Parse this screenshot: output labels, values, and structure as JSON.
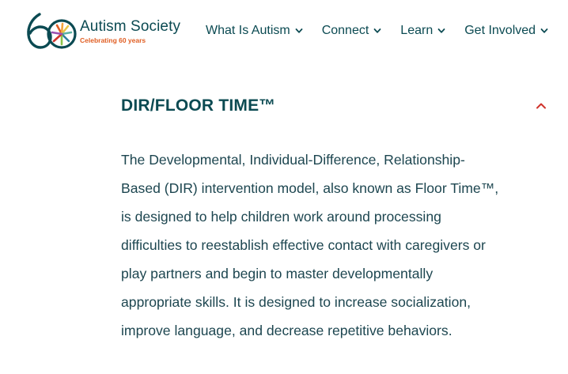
{
  "brand": {
    "logo_number": "60",
    "name": "Autism Society",
    "tagline": "Celebrating 60 years",
    "colors": {
      "teal": "#0b4a52",
      "orange": "#e05e23",
      "red": "#d0342c"
    }
  },
  "nav": {
    "items": [
      {
        "label": "What Is Autism",
        "icon": "chevron-down-icon"
      },
      {
        "label": "Connect",
        "icon": "chevron-down-icon"
      },
      {
        "label": "Learn",
        "icon": "chevron-down-icon"
      },
      {
        "label": "Get Involved",
        "icon": "chevron-down-icon"
      }
    ]
  },
  "accordion": {
    "title": "DIR/FLOOR TIME™",
    "expanded": true,
    "toggle_icon": "chevron-up-icon",
    "body": "The Developmental, Individual-Difference, Relationship-Based (DIR) intervention model, also known as Floor Time™, is designed to help children work around processing difficulties to reestablish effective contact with caregivers or play partners and begin to master developmentally appropriate skills. It is designed to increase socialization, improve language, and decrease repetitive behaviors."
  }
}
